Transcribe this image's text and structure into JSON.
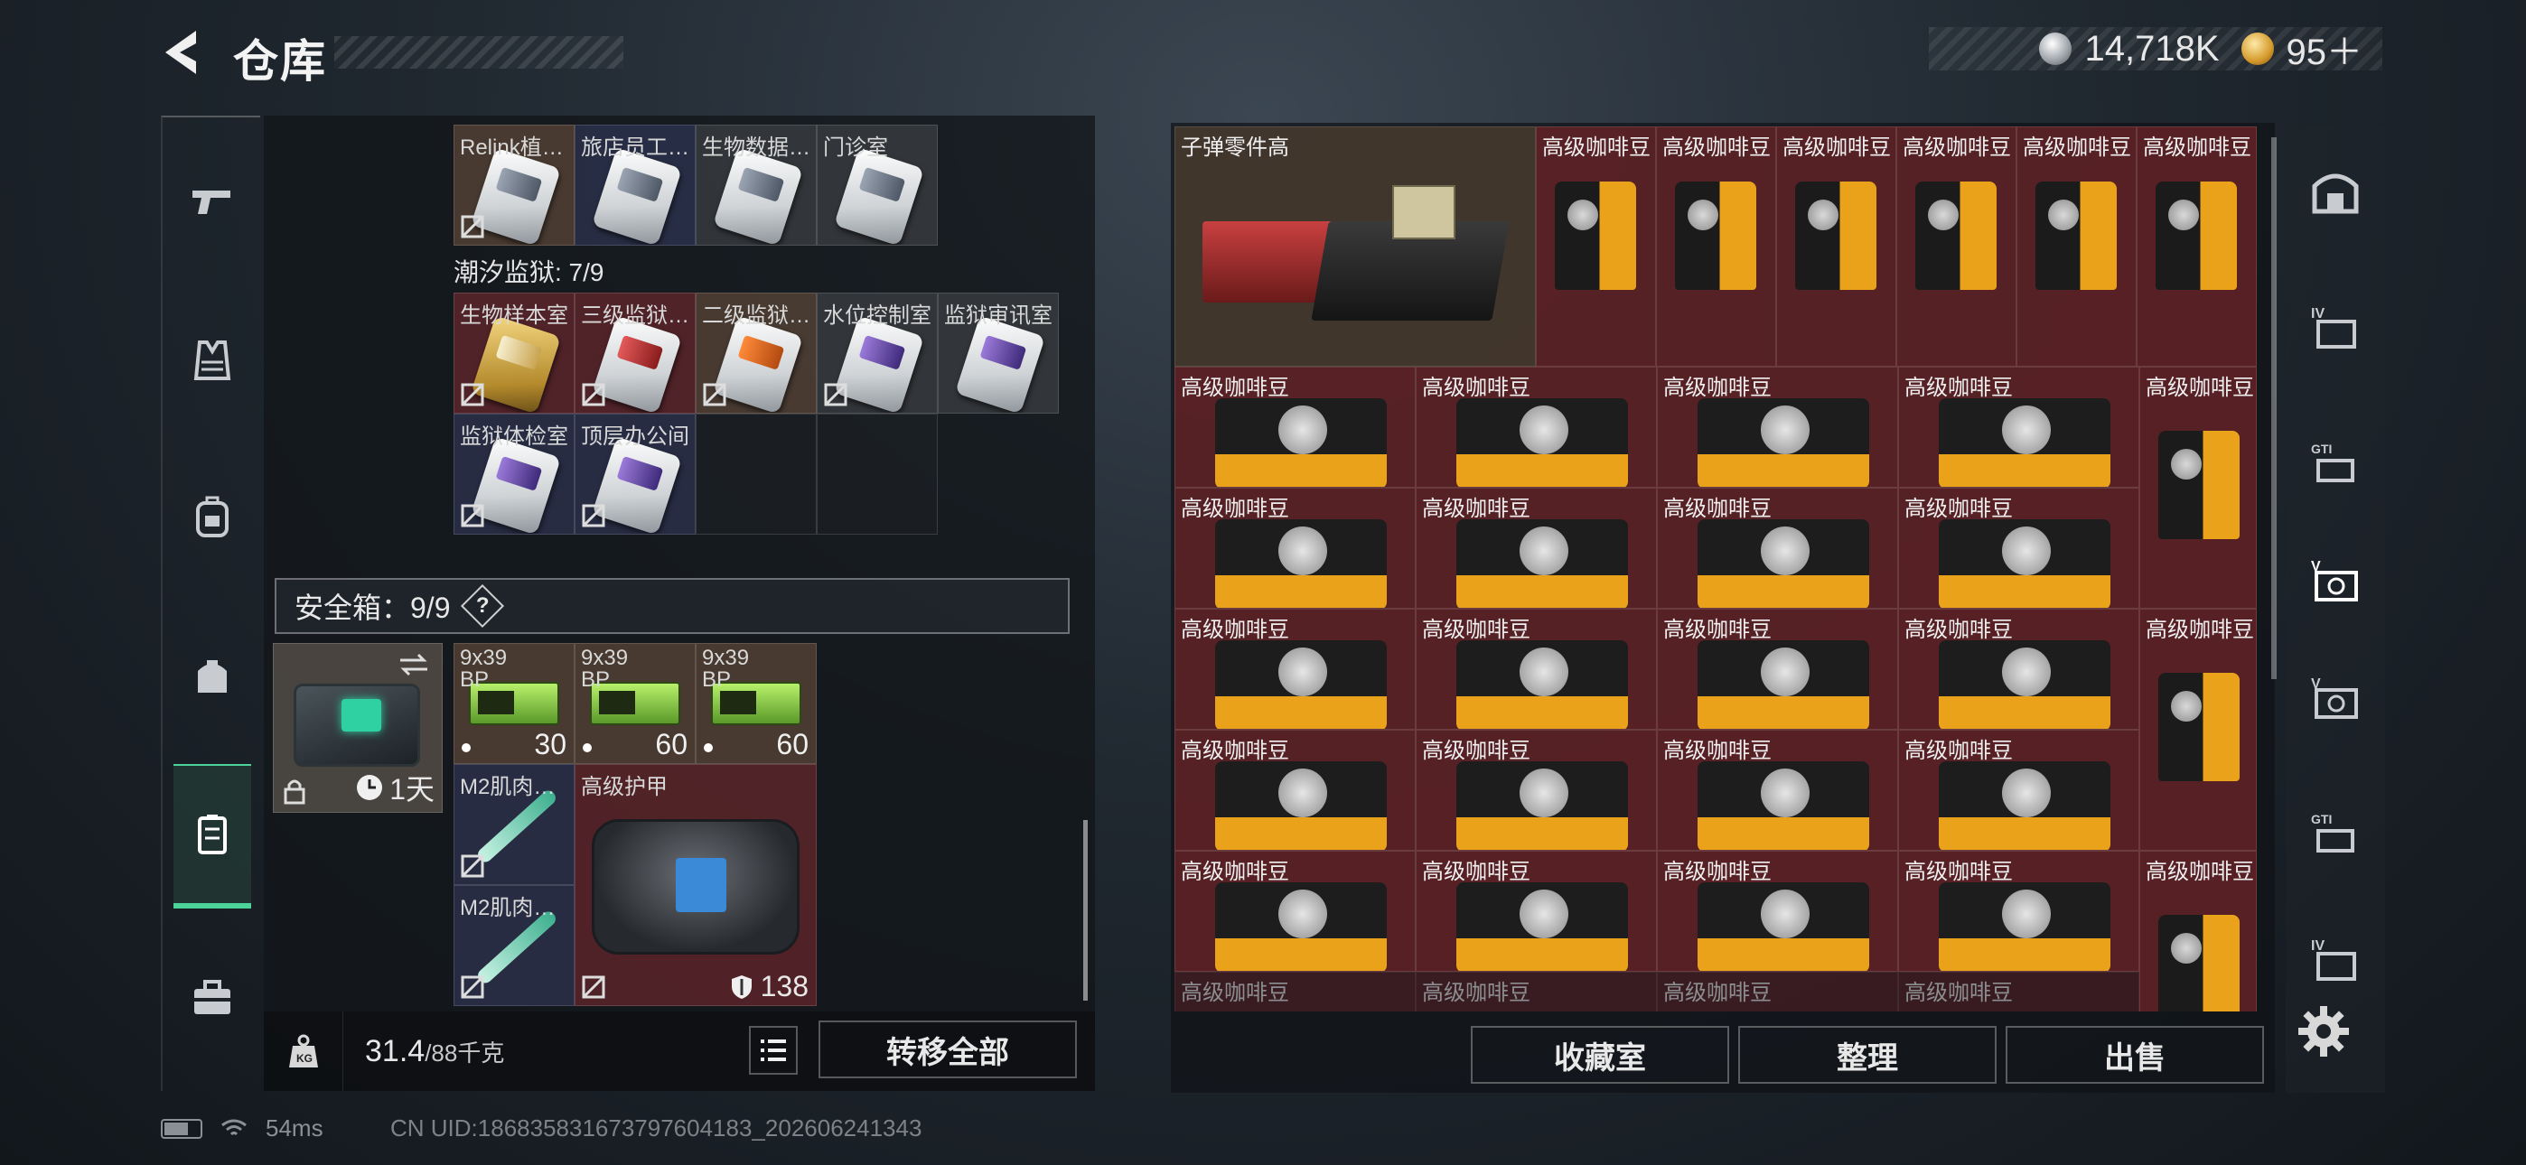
{
  "header": {
    "title": "仓库"
  },
  "currency": {
    "silver": "14,718K",
    "gold": "95＋"
  },
  "left_rail": [
    {
      "name": "rail-weapon",
      "icon": "pistol-icon"
    },
    {
      "name": "rail-armor",
      "icon": "vest-icon"
    },
    {
      "name": "rail-backpack",
      "icon": "backpack-icon"
    },
    {
      "name": "rail-chest-rig",
      "icon": "rig-icon"
    },
    {
      "name": "rail-storage",
      "icon": "storage-icon",
      "active": true
    },
    {
      "name": "rail-briefcase",
      "icon": "briefcase-icon"
    }
  ],
  "left": {
    "keycards_top": [
      {
        "label": "Relink植…",
        "color": "grey"
      },
      {
        "label": "旅店员工…",
        "color": "grey"
      },
      {
        "label": "生物数据…",
        "color": "grey"
      },
      {
        "label": "门诊室",
        "color": "grey"
      }
    ],
    "prison_label": "潮汐监狱: 7/9",
    "prison_cards": [
      {
        "label": "生物样本室",
        "color": "gold"
      },
      {
        "label": "三级监狱…",
        "color": "red"
      },
      {
        "label": "二级监狱…",
        "color": "orange"
      },
      {
        "label": "水位控制室",
        "color": "purple"
      },
      {
        "label": "监狱审讯室",
        "color": "purple"
      },
      {
        "label": "监狱体检室",
        "color": "purple"
      },
      {
        "label": "顶层办公间",
        "color": "purple"
      }
    ],
    "safe_box": {
      "label": "安全箱：9/9",
      "help": "?",
      "timer": "1天"
    },
    "ammo": [
      {
        "label": "9x39\nBP",
        "count": "30"
      },
      {
        "label": "9x39\nBP",
        "count": "60"
      },
      {
        "label": "9x39\nBP",
        "count": "60"
      }
    ],
    "meds": [
      {
        "label": "M2肌肉…"
      },
      {
        "label": "M2肌肉…"
      }
    ],
    "armor": {
      "label": "高级护甲",
      "durability": "138"
    },
    "footer": {
      "weight": "31.4",
      "capacity": "/88千克",
      "transfer": "转移全部"
    }
  },
  "right": {
    "top_item": "子弹零件高",
    "coffee": "高级咖啡豆",
    "buttons": {
      "collection": "收藏室",
      "sort": "整理",
      "sell": "出售"
    }
  },
  "right_rail": [
    {
      "name": "rrail-home",
      "icon": "bunker-icon"
    },
    {
      "name": "rrail-iv-1",
      "icon": "iv-case-icon",
      "text": "IV"
    },
    {
      "name": "rrail-gti-1",
      "icon": "gti-case-icon",
      "text": "GTI"
    },
    {
      "name": "rrail-v-1",
      "icon": "v-case-icon",
      "text": "V",
      "active": true
    },
    {
      "name": "rrail-v-2",
      "icon": "v-case-icon",
      "text": "V"
    },
    {
      "name": "rrail-gti-2",
      "icon": "gti-case-icon",
      "text": "GTI"
    },
    {
      "name": "rrail-iv-2",
      "icon": "iv-case-icon",
      "text": "IV"
    }
  ],
  "status": {
    "ping": "54ms",
    "uid": "CN UID:186835831673797604183_202606241343"
  },
  "colors": {
    "accent": "#4cd39a",
    "item_bg": "#5c2226"
  }
}
